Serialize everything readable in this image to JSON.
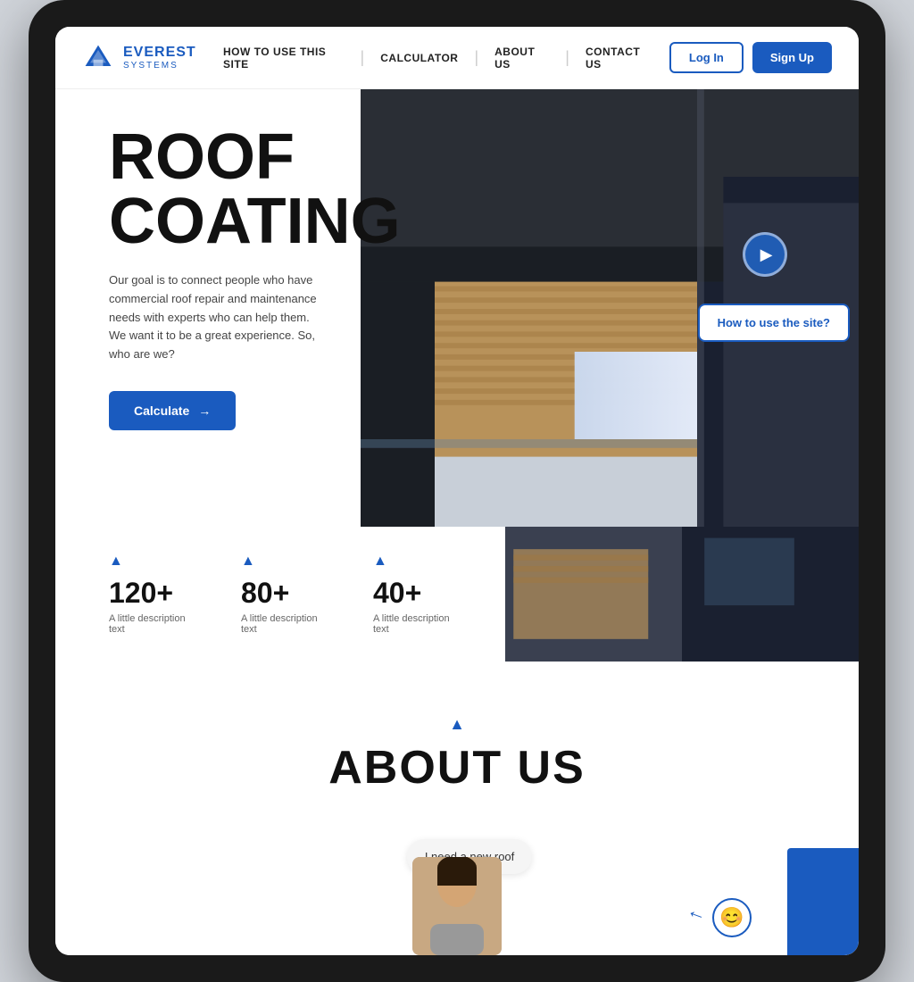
{
  "device": {
    "bg_color": "#d0d4da"
  },
  "navbar": {
    "logo_name": "EVEREST",
    "logo_sub": "SYSTEMS",
    "nav_items": [
      {
        "label": "HOW TO USE THIS SITE",
        "id": "how-to-use"
      },
      {
        "label": "CALCULATOR",
        "id": "calculator"
      },
      {
        "label": "ABOUT US",
        "id": "about-us"
      },
      {
        "label": "CONTACT US",
        "id": "contact-us"
      }
    ],
    "login_label": "Log In",
    "signup_label": "Sign Up"
  },
  "hero": {
    "title_line1": "ROOF",
    "title_line2": "COATING",
    "description": "Our goal is to connect people who have commercial roof repair and maintenance needs with experts who can help them. We want it to be a great experience. So, who are we?",
    "calculate_btn": "Calculate",
    "how_to_btn": "How to use the site?",
    "play_btn_label": "Play video"
  },
  "stats": [
    {
      "number": "120+",
      "desc": "A little description text"
    },
    {
      "number": "80+",
      "desc": "A little description text"
    },
    {
      "number": "40+",
      "desc": "A little description text"
    }
  ],
  "about": {
    "accent_icon": "▲",
    "title": "ABOUT US"
  },
  "chat": {
    "bubble_text": "I need a new roof",
    "emoji": "😊"
  }
}
